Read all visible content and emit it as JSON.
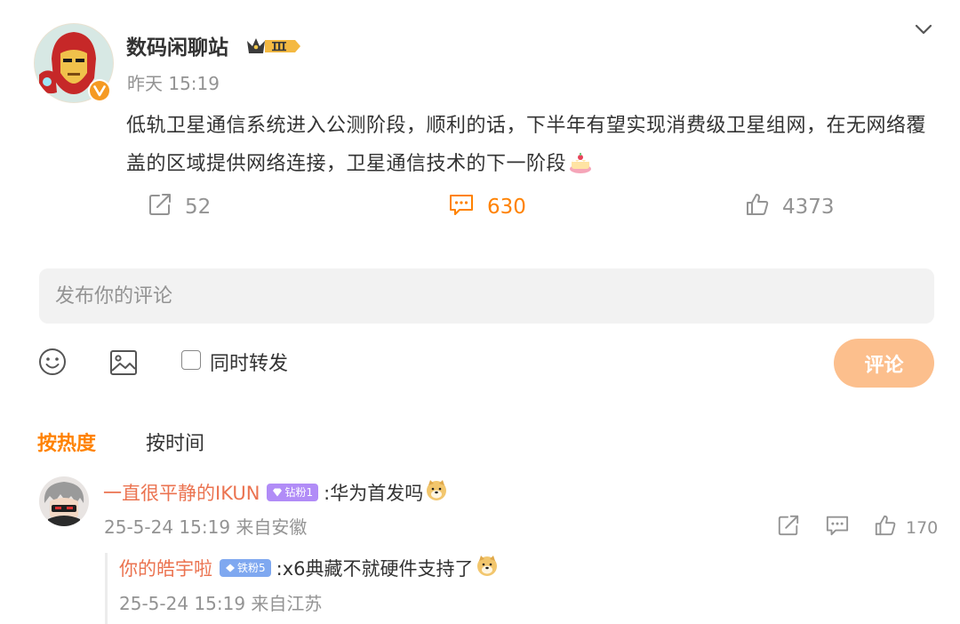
{
  "post": {
    "author": "数码闲聊站",
    "time": "昨天 15:19",
    "text": "低轨卫星通信系统进入公测阶段，顺利的话，下半年有望实现消费级卫星组网，在无网络覆盖的区域提供网络连接，卫星通信技术的下一阶段",
    "shares": "52",
    "comments": "630",
    "likes": "4373",
    "icons": [
      "avatar-ironman",
      "crown-badge",
      "verified-v-icon",
      "chevron-down-icon",
      "share-icon",
      "comment-icon",
      "like-icon",
      "cake-emoji"
    ]
  },
  "compose": {
    "placeholder": "发布你的评论",
    "forward_label": "同时转发",
    "submit_label": "评论",
    "icons": [
      "emoji-icon",
      "image-icon",
      "checkbox"
    ]
  },
  "sort": {
    "hot": "按热度",
    "time": "按时间"
  },
  "comments": [
    {
      "user": "一直很平静的IKUN",
      "badge": "钻粉1",
      "text": ":华为首发吗",
      "meta": "25-5-24 15:19 来自安徽",
      "likes": "170",
      "replies": [
        {
          "user": "你的皓宇啦",
          "badge": "铁粉5",
          "text": ":x6典藏不就硬件支持了",
          "meta": "25-5-24 15:19 来自江苏"
        }
      ]
    }
  ],
  "colors": {
    "accent": "#ff8200",
    "username": "#eb7350",
    "muted": "#939393",
    "submit_disabled": "#fcbf8d",
    "input_bg": "#f2f2f2",
    "diamond_badge": "#b18cf7",
    "iron_badge": "#7fa8f0"
  }
}
